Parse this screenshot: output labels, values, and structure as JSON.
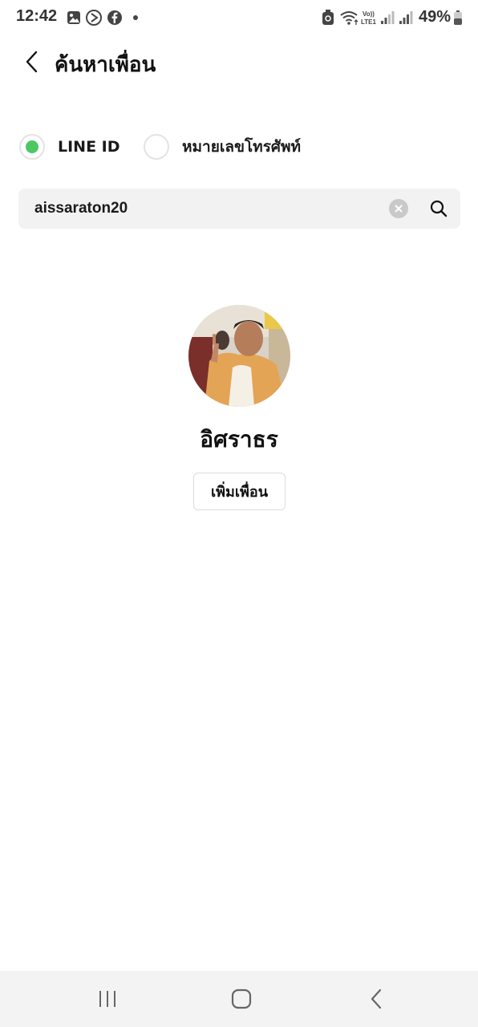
{
  "status_bar": {
    "time": "12:42",
    "battery_percent": "49%",
    "left_icons": [
      "gallery-icon",
      "media-icon",
      "facebook-icon",
      "dot-icon"
    ],
    "right_icons": [
      "cleaner-icon",
      "wifi-icon",
      "volte-lte-icon",
      "signal-icon",
      "signal-icon",
      "battery-icon"
    ]
  },
  "header": {
    "title": "ค้นหาเพื่อน"
  },
  "search_type": {
    "options": [
      {
        "label": "LINE ID",
        "selected": true
      },
      {
        "label": "หมายเลขโทรศัพท์",
        "selected": false
      }
    ],
    "accent_color": "#4cc764"
  },
  "search": {
    "value": "aissaraton20"
  },
  "result": {
    "name": "อิศราธร",
    "add_button_label": "เพิ่มเพื่อน"
  },
  "nav_bar": {
    "buttons": [
      "recents-icon",
      "home-icon",
      "back-icon"
    ]
  }
}
